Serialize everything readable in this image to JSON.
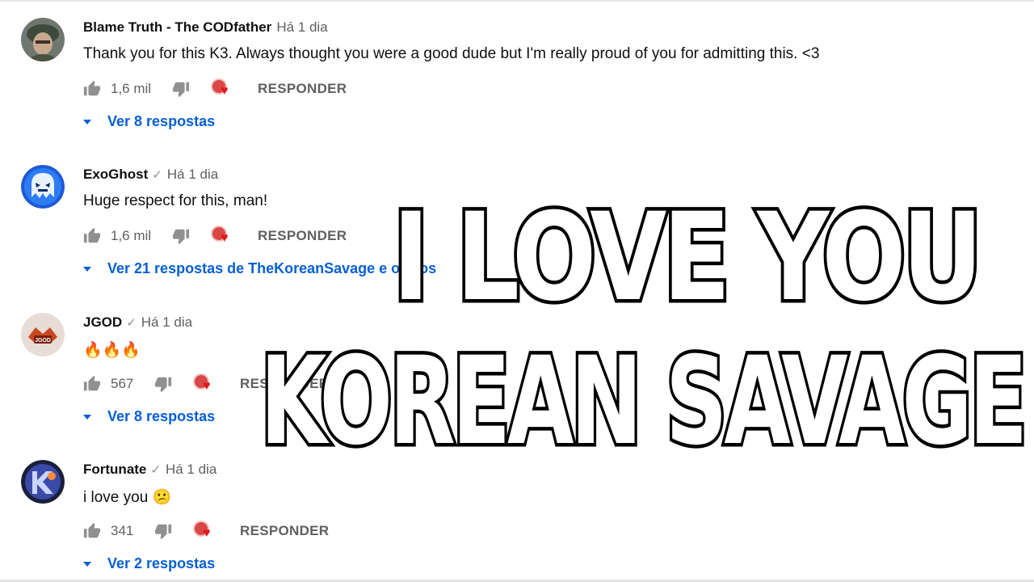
{
  "comments": [
    {
      "author": "Blame Truth - The CODfather",
      "verified": false,
      "time": "Há 1 dia",
      "text": "Thank you for this K3. Always thought you were a good dude but I'm really proud of you for admitting this. <3",
      "likes": "1,6 mil",
      "reply_label": "RESPONDER",
      "replies_label": "Ver 8 respostas"
    },
    {
      "author": "ExoGhost",
      "verified": true,
      "time": "Há 1 dia",
      "text": "Huge respect for this, man!",
      "likes": "1,6 mil",
      "reply_label": "RESPONDER",
      "replies_label": "Ver 21 respostas de TheKoreanSavage e outros"
    },
    {
      "author": "JGOD",
      "verified": true,
      "time": "Há 1 dia",
      "text": "🔥🔥🔥",
      "likes": "567",
      "reply_label": "RESPONDER",
      "replies_label": "Ver 8 respostas"
    },
    {
      "author": "Fortunate",
      "verified": true,
      "time": "Há 1 dia",
      "text": "i love you 😕",
      "likes": "341",
      "reply_label": "RESPONDER",
      "replies_label": "Ver 2 respostas"
    }
  ],
  "overlay": {
    "line1": "I LOVE YOU",
    "line2": "KOREAN SAVAGE"
  },
  "colors": {
    "link_blue": "#065fd4",
    "meta_gray": "#606060",
    "heart_red": "#e01b1b"
  }
}
